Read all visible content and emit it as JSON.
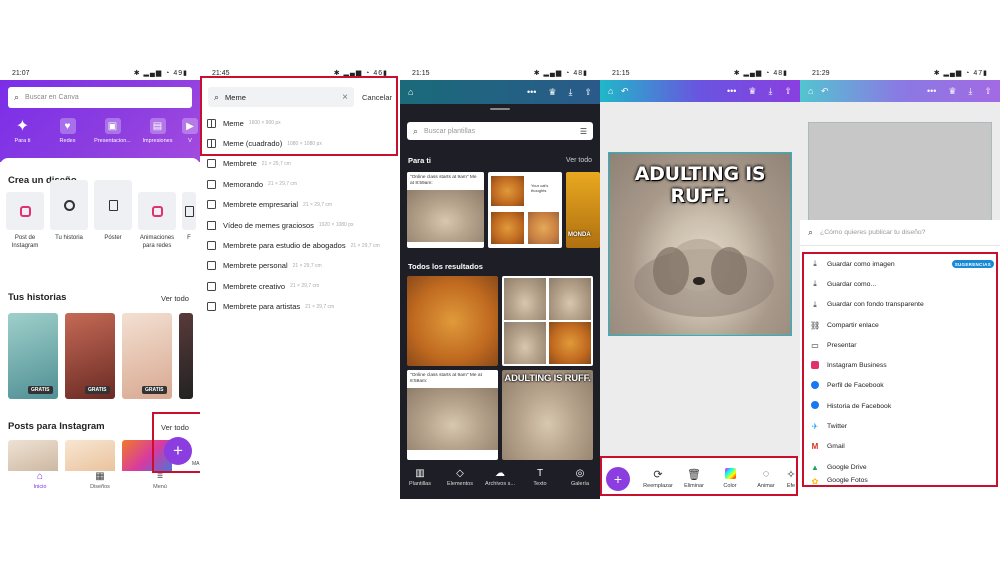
{
  "phone1": {
    "status": {
      "time": "21:07",
      "battery": "49"
    },
    "search_placeholder": "Buscar en Canva",
    "categories": [
      "Para ti",
      "Redes",
      "Presentacion...",
      "Impresiones",
      "V"
    ],
    "create_title": "Crea un diseño",
    "designs": [
      {
        "label": "Post de Instagram",
        "icon": "instagram-icon"
      },
      {
        "label": "Tu historia",
        "icon": "story-icon"
      },
      {
        "label": "Póster",
        "icon": "poster-icon"
      },
      {
        "label": "Animaciones para redes",
        "icon": "instagram-icon"
      },
      {
        "label": "F",
        "icon": "file-icon"
      }
    ],
    "stories_title": "Tus historias",
    "stories_link": "Ver todo",
    "stories": [
      {
        "badge": "GRATIS",
        "color": "#7fb8b3"
      },
      {
        "badge": "GRATIS",
        "color": "#a8584a"
      },
      {
        "badge": "GRATIS",
        "color": "#e8c9b8"
      },
      {
        "badge": "",
        "color": "#3a2a2a"
      }
    ],
    "posts_title": "Posts para Instagram",
    "posts_link": "Ver todo",
    "post_colors": [
      "#e6d7c8",
      "#f0d7c0",
      "#d85a9a",
      "#cfc6ee"
    ],
    "post_tag": "MA",
    "fab_label": "+",
    "nav": [
      {
        "label": "Inicio",
        "icon": "home-icon"
      },
      {
        "label": "Diseños",
        "icon": "grid-icon"
      },
      {
        "label": "Menú",
        "icon": "menu-icon"
      }
    ]
  },
  "phone2": {
    "status": {
      "time": "21:45",
      "battery": "46"
    },
    "search_value": "Meme",
    "cancel": "Cancelar",
    "results": [
      {
        "name": "Meme",
        "dim": "1600 × 900 px",
        "icon": "grid"
      },
      {
        "name": "Meme (cuadrado)",
        "dim": "1080 × 1080 px",
        "icon": "grid"
      },
      {
        "name": "Membrete",
        "dim": "21 × 29,7 cm",
        "icon": "doc"
      },
      {
        "name": "Memorando",
        "dim": "21 × 29,7 cm",
        "icon": "doc"
      },
      {
        "name": "Membrete empresarial",
        "dim": "21 × 29,7 cm",
        "icon": "doc"
      },
      {
        "name": "Vídeo de memes graciosos",
        "dim": "1920 × 1080 px",
        "icon": "play"
      },
      {
        "name": "Membrete para estudio de abogados",
        "dim": "21 × 29,7 cm",
        "icon": "doc"
      },
      {
        "name": "Membrete personal",
        "dim": "21 × 29,7 cm",
        "icon": "doc"
      },
      {
        "name": "Membrete creativo",
        "dim": "21 × 29,7 cm",
        "icon": "doc"
      },
      {
        "name": "Membrete para artistas",
        "dim": "21 × 29,7 cm",
        "icon": "doc"
      }
    ]
  },
  "phone3": {
    "status": {
      "time": "21:15",
      "battery": "48"
    },
    "search_placeholder": "Buscar plantillas",
    "for_you": "Para ti",
    "see_all": "Ver todo",
    "all_results": "Todos los resultados",
    "tpl_caption_1": "\"Online class starts at 9am\" Me at 8:59am:",
    "tpl_caption_2": "\"Online class starts at 9am\" Me at 8:59am:",
    "tpl_meme_text": "ADULTING IS RUFF.",
    "tpl_side_text": "MONDA",
    "tpl_cat_text": "Your cat's thoughts",
    "nav": [
      {
        "label": "Plantillas",
        "icon": "template-icon"
      },
      {
        "label": "Elementos",
        "icon": "shapes-icon"
      },
      {
        "label": "Archivos s...",
        "icon": "upload-icon"
      },
      {
        "label": "Texto",
        "icon": "text-icon"
      },
      {
        "label": "Galería",
        "icon": "gallery-icon"
      }
    ]
  },
  "phone4": {
    "status": {
      "time": "21:15",
      "battery": "48"
    },
    "meme_text": "ADULTING IS RUFF.",
    "fab_label": "+",
    "tools": [
      {
        "label": "Reemplazar",
        "icon": "replace-icon"
      },
      {
        "label": "Eliminar",
        "icon": "trash-icon"
      },
      {
        "label": "Color",
        "icon": "color-icon"
      },
      {
        "label": "Animar",
        "icon": "animate-icon"
      },
      {
        "label": "Efe",
        "icon": "effects-icon"
      }
    ]
  },
  "phone5": {
    "status": {
      "time": "21:29",
      "battery": "47"
    },
    "question": "¿Cómo quieres publicar tu diseño?",
    "suggestions_badge": "SUGERENCIAS",
    "options": [
      {
        "label": "Guardar como imagen",
        "icon": "download-icon",
        "color": "#333333"
      },
      {
        "label": "Guardar como...",
        "icon": "download-icon",
        "color": "#333333"
      },
      {
        "label": "Guardar con fondo transparente",
        "icon": "download-icon",
        "color": "#333333"
      },
      {
        "label": "Compartir enlace",
        "icon": "link-icon",
        "color": "#333333"
      },
      {
        "label": "Presentar",
        "icon": "present-icon",
        "color": "#333333"
      },
      {
        "label": "Instagram Business",
        "icon": "instagram-icon",
        "color": "#e1306c"
      },
      {
        "label": "Perfil de Facebook",
        "icon": "facebook-icon",
        "color": "#1877f2"
      },
      {
        "label": "Historia de Facebook",
        "icon": "facebook-icon",
        "color": "#1877f2"
      },
      {
        "label": "Twitter",
        "icon": "twitter-icon",
        "color": "#1da1f2"
      },
      {
        "label": "Gmail",
        "icon": "gmail-icon",
        "color": "#d93025"
      },
      {
        "label": "Google Drive",
        "icon": "drive-icon",
        "color": "#1fa463"
      },
      {
        "label": "Google Fotos",
        "icon": "photos-icon",
        "color": "#fbbc04"
      }
    ]
  },
  "colors": {
    "accent": "#8b3de0",
    "highlight": "#c8102e",
    "selection": "#1fb8c8"
  }
}
